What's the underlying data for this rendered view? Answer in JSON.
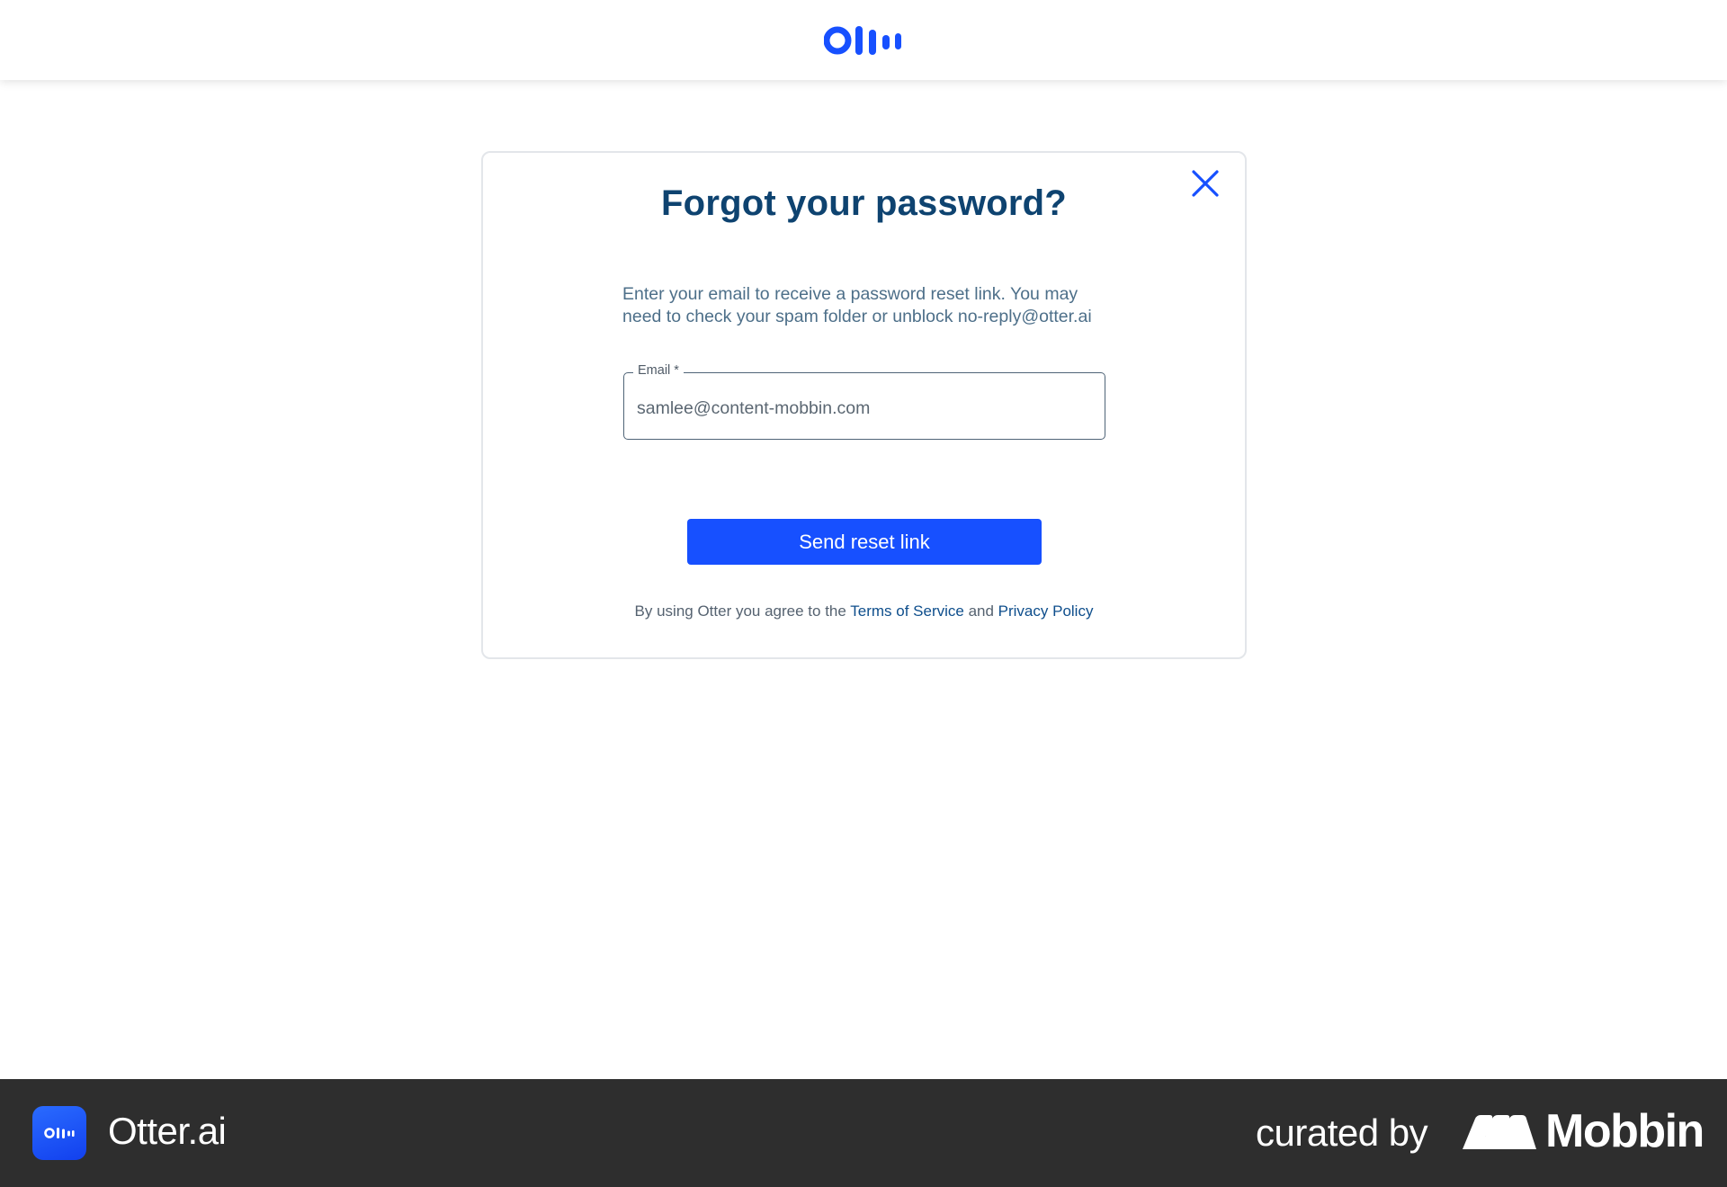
{
  "header": {
    "logo_icon": "otter-logo-icon"
  },
  "dialog": {
    "close_icon": "close-icon",
    "title": "Forgot your password?",
    "description": "Enter your email to receive a password reset link. You may need to check your spam folder or unblock no-reply@otter.ai",
    "email_label": "Email *",
    "email_value": "samlee@content-mobbin.com",
    "submit_label": "Send reset link",
    "terms_prefix": "By using Otter you agree to the ",
    "terms_link": "Terms of Service",
    "terms_and": " and ",
    "privacy_link": "Privacy Policy"
  },
  "banner": {
    "app_icon": "otter-app-icon",
    "app_name": "Otter.ai",
    "curated_by": "curated by",
    "brand_icon": "mobbin-logo-icon",
    "brand_name": "Mobbin"
  },
  "colors": {
    "brand_blue": "#1750ff",
    "title_navy": "#0e4370",
    "link_navy": "#0e4e8c",
    "banner_bg": "#2e2e2e"
  }
}
